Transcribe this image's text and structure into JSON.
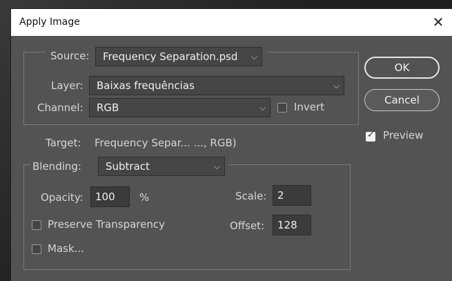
{
  "dialog": {
    "title": "Apply Image",
    "close_glyph": "✕"
  },
  "source": {
    "label": "Source:",
    "file": "Frequency Separation.psd",
    "layer_label": "Layer:",
    "layer": "Baixas frequências",
    "channel_label": "Channel:",
    "channel": "RGB",
    "invert_label": "Invert",
    "invert_checked": false
  },
  "target": {
    "label": "Target:",
    "value": "Frequency Separ... ..., RGB)"
  },
  "blending": {
    "label": "Blending:",
    "mode": "Subtract",
    "opacity_label": "Opacity:",
    "opacity": "100",
    "opacity_unit": "%",
    "scale_label": "Scale:",
    "scale": "2",
    "offset_label": "Offset:",
    "offset": "128",
    "preserve_label": "Preserve Transparency",
    "preserve_checked": false,
    "mask_label": "Mask...",
    "mask_checked": false
  },
  "buttons": {
    "ok": "OK",
    "cancel": "Cancel",
    "preview_label": "Preview",
    "preview_checked": true
  },
  "icons": {
    "dropdown": "chevron-down-icon",
    "close": "close-icon",
    "check": "checkmark-icon"
  },
  "colors": {
    "dialog_bg": "#535353",
    "titlebar_bg": "#ffffff",
    "field_bg": "#454545"
  }
}
